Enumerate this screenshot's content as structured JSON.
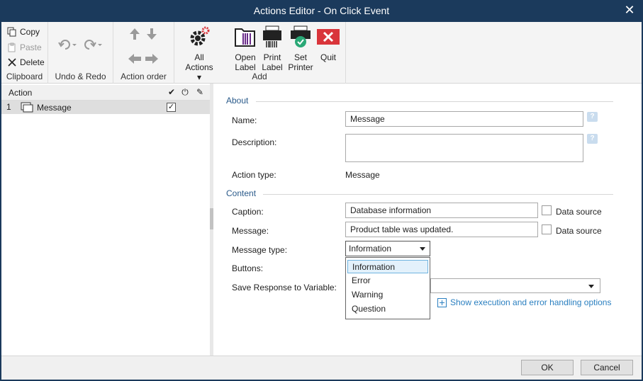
{
  "window": {
    "title": "Actions Editor - On Click Event",
    "close_glyph": "✕"
  },
  "ribbon": {
    "clipboard": {
      "copy": "Copy",
      "paste": "Paste",
      "delete": "Delete",
      "label": "Clipboard"
    },
    "undo_redo": {
      "label": "Undo & Redo"
    },
    "action_order": {
      "label": "Action order"
    },
    "all_actions": {
      "line1": "All",
      "line2": "Actions"
    },
    "add": {
      "label": "Add",
      "open_label": [
        "Open",
        "Label"
      ],
      "print_label": [
        "Print",
        "Label"
      ],
      "set_printer": [
        "Set",
        "Printer"
      ],
      "quit": "Quit"
    }
  },
  "tree": {
    "header": {
      "action": "Action"
    },
    "rows": [
      {
        "num": "1",
        "label": "Message",
        "checked": "✓"
      }
    ]
  },
  "form": {
    "about_section": "About",
    "name_label": "Name:",
    "name_value": "Message",
    "description_label": "Description:",
    "description_value": "",
    "action_type_label": "Action type:",
    "action_type_value": "Message",
    "content_section": "Content",
    "caption_label": "Caption:",
    "caption_value": "Database information",
    "message_label": "Message:",
    "message_value": "Product table was updated.",
    "data_source_label": "Data source",
    "message_type_label": "Message type:",
    "message_type_value": "Information",
    "message_type_options": [
      "Information",
      "Error",
      "Warning",
      "Question"
    ],
    "buttons_label": "Buttons:",
    "save_response_label": "Save Response to Variable:",
    "show_options_link": "Show execution and error handling options",
    "help_glyph": "?"
  },
  "footer": {
    "ok": "OK",
    "cancel": "Cancel"
  },
  "colors": {
    "titlebar": "#1b3a5c",
    "section": "#2a5a8a",
    "link": "#2a7fc0",
    "quit_red": "#d9353b"
  }
}
